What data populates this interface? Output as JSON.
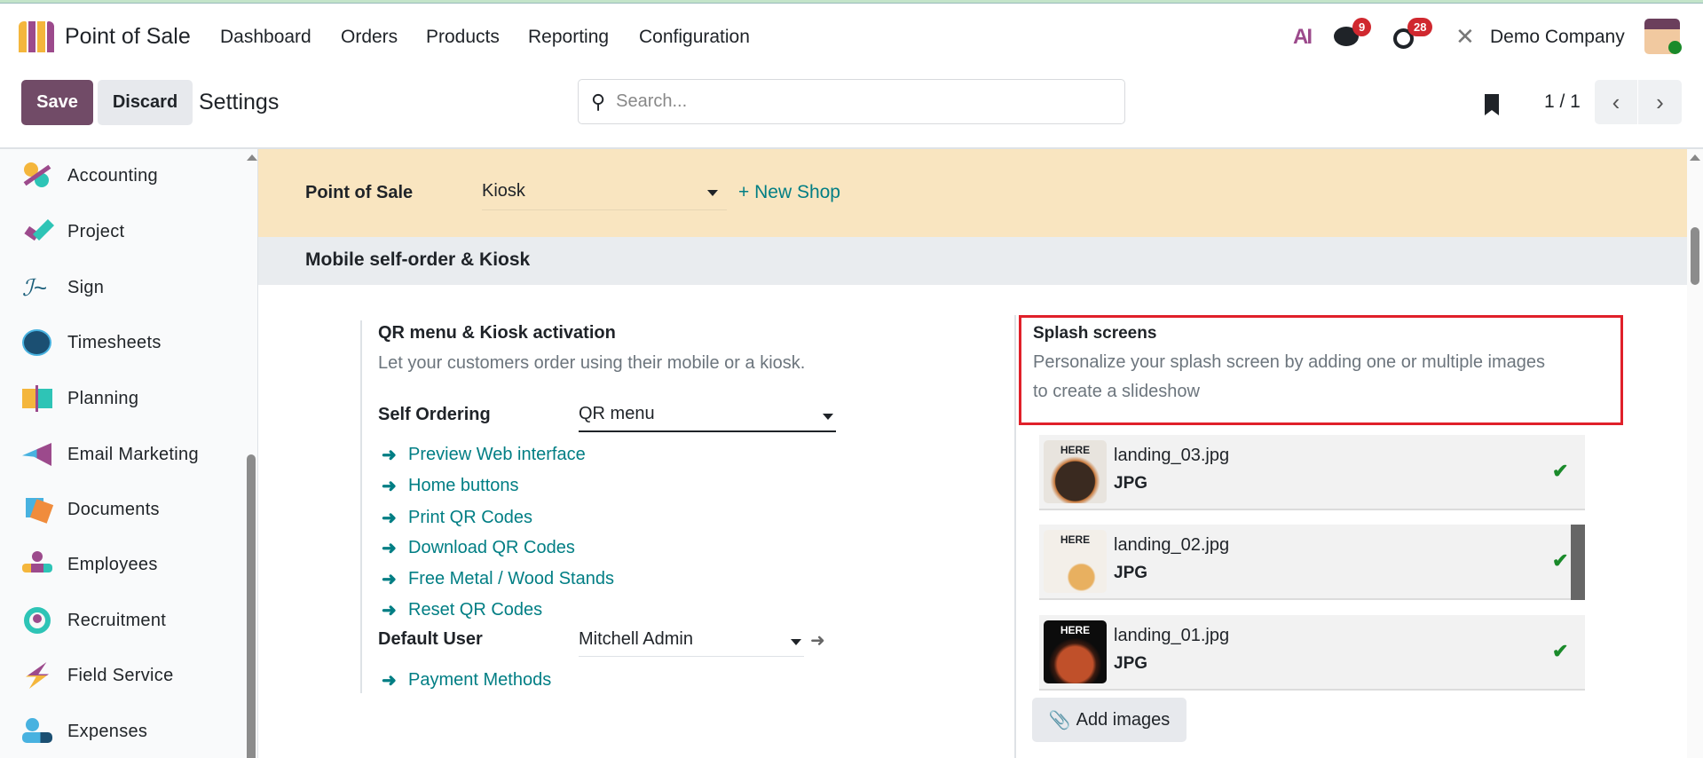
{
  "app": {
    "title": "Point of Sale",
    "menu": [
      "Dashboard",
      "Orders",
      "Products",
      "Reporting",
      "Configuration"
    ],
    "ai_label": "AI",
    "messages_count": "9",
    "activities_count": "28",
    "company": "Demo Company"
  },
  "control": {
    "save": "Save",
    "discard": "Discard",
    "breadcrumb": "Settings",
    "search_placeholder": "Search...",
    "pager": "1 / 1"
  },
  "sidebar": {
    "items": [
      {
        "label": "Accounting"
      },
      {
        "label": "Project"
      },
      {
        "label": "Sign"
      },
      {
        "label": "Timesheets"
      },
      {
        "label": "Planning"
      },
      {
        "label": "Email Marketing"
      },
      {
        "label": "Documents"
      },
      {
        "label": "Employees"
      },
      {
        "label": "Recruitment"
      },
      {
        "label": "Field Service"
      },
      {
        "label": "Expenses"
      }
    ]
  },
  "shop_bar": {
    "label": "Point of Sale",
    "value": "Kiosk",
    "new_shop": "+ New Shop"
  },
  "section": {
    "title": "Mobile self-order & Kiosk"
  },
  "qr": {
    "title": "QR menu & Kiosk activation",
    "description": "Let your customers order using their mobile or a kiosk.",
    "self_ordering_label": "Self Ordering",
    "self_ordering_value": "QR menu",
    "links": [
      "Preview Web interface",
      "Home buttons",
      "Print QR Codes",
      "Download QR Codes",
      "Free Metal / Wood Stands",
      "Reset QR Codes"
    ],
    "default_user_label": "Default User",
    "default_user_value": "Mitchell Admin",
    "payment_methods": "Payment Methods"
  },
  "splash": {
    "title": "Splash screens",
    "description_line1": "Personalize your splash screen by adding one or multiple images",
    "description_line2": "to create a slideshow",
    "images": [
      {
        "name": "landing_03.jpg",
        "type": "JPG",
        "thumb_text": "HERE"
      },
      {
        "name": "landing_02.jpg",
        "type": "JPG",
        "thumb_text": "HERE"
      },
      {
        "name": "landing_01.jpg",
        "type": "JPG",
        "thumb_text": "HERE"
      }
    ],
    "add_images": "Add images"
  },
  "colors": {
    "primary": "#714b67",
    "link": "#017e84",
    "highlight": "#e0202a",
    "shop_bar": "#f9e5c0"
  }
}
